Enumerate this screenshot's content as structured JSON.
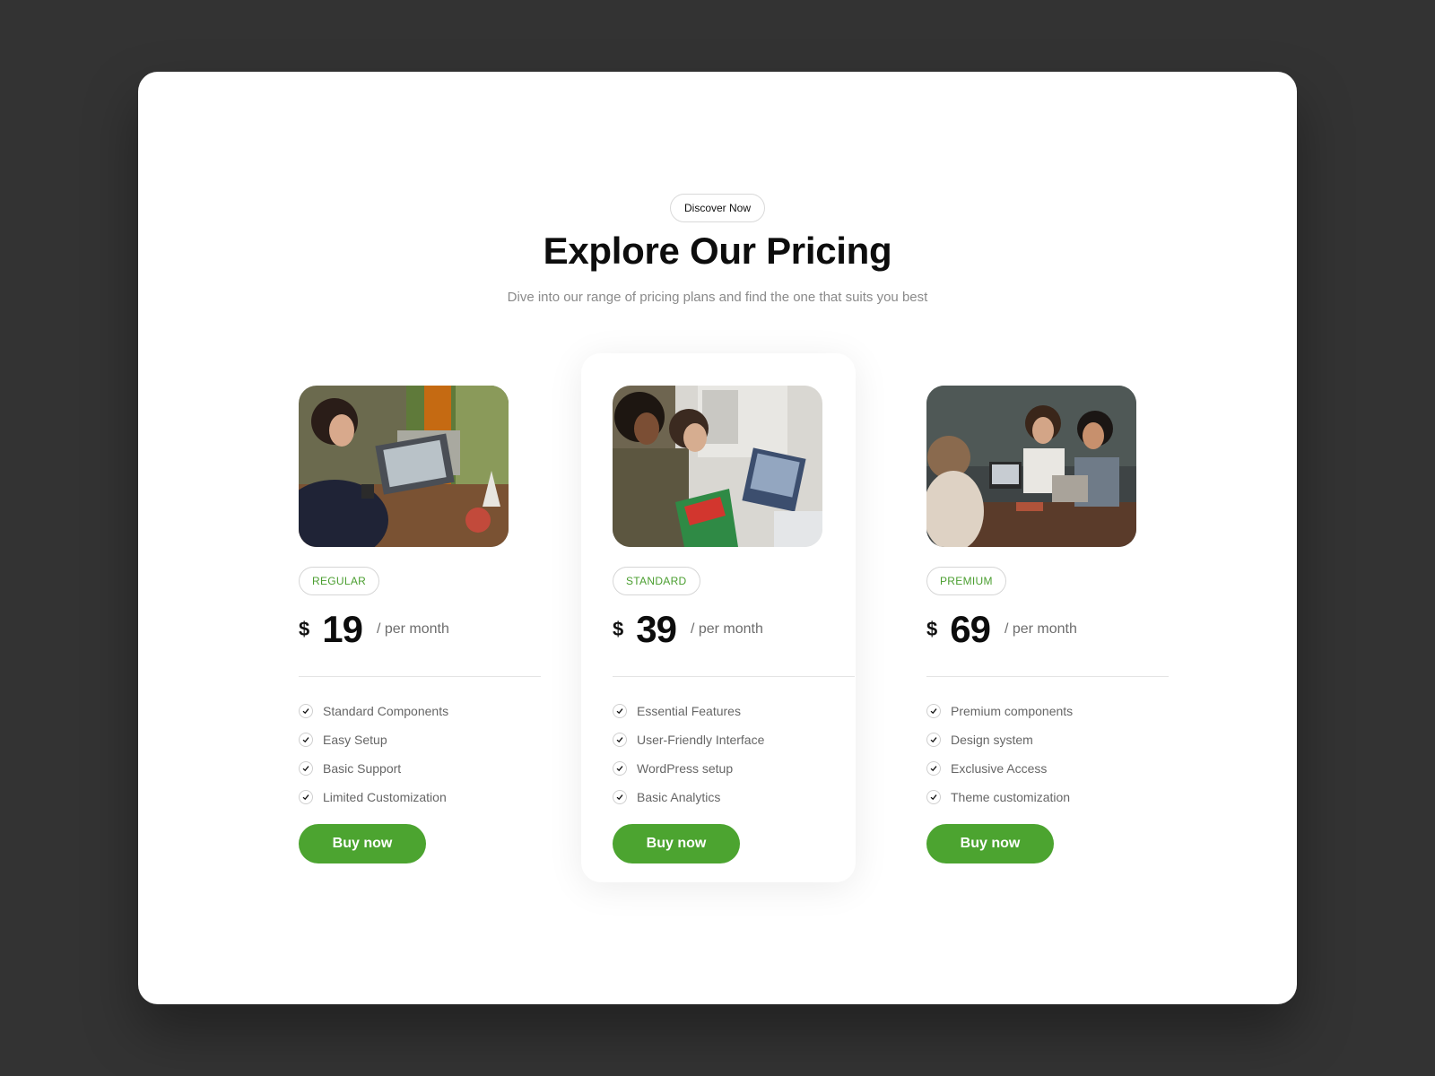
{
  "header": {
    "badge_label": "Discover Now",
    "title": "Explore Our Pricing",
    "subtitle": "Dive into our range of pricing plans and find the one that suits you best"
  },
  "plans": [
    {
      "tier": "REGULAR",
      "currency": "$",
      "price": "19",
      "period": "/ per month",
      "features": [
        "Standard Components",
        "Easy Setup",
        "Basic Support",
        "Limited Customization"
      ],
      "cta": "Buy now"
    },
    {
      "tier": "STANDARD",
      "currency": "$",
      "price": "39",
      "period": "/ per month",
      "features": [
        "Essential Features",
        "User-Friendly Interface",
        "WordPress setup",
        "Basic Analytics"
      ],
      "cta": "Buy now"
    },
    {
      "tier": "PREMIUM",
      "currency": "$",
      "price": "69",
      "period": "/ per month",
      "features": [
        "Premium components",
        "Design system",
        "Exclusive Access",
        "Theme customization"
      ],
      "cta": "Buy now"
    }
  ],
  "colors": {
    "accent": "#4ca430",
    "tier_text": "#4a9e2f",
    "backdrop": "#333333"
  },
  "icons": {
    "feature_bullet": "check-circle-icon"
  }
}
